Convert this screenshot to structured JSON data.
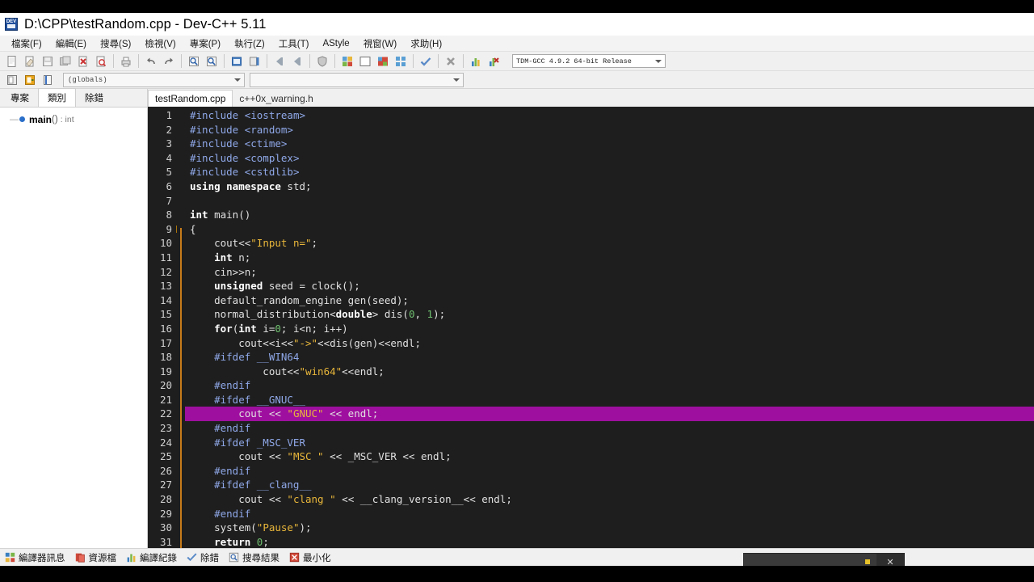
{
  "window": {
    "title": "D:\\CPP\\testRandom.cpp - Dev-C++ 5.11",
    "icon": "devcpp-app-icon"
  },
  "menubar": {
    "items": [
      {
        "label": "檔案(F)",
        "name": "menu-file"
      },
      {
        "label": "編輯(E)",
        "name": "menu-edit"
      },
      {
        "label": "搜尋(S)",
        "name": "menu-search"
      },
      {
        "label": "檢視(V)",
        "name": "menu-view"
      },
      {
        "label": "專案(P)",
        "name": "menu-project"
      },
      {
        "label": "執行(Z)",
        "name": "menu-execute"
      },
      {
        "label": "工具(T)",
        "name": "menu-tools"
      },
      {
        "label": "AStyle",
        "name": "menu-astyle"
      },
      {
        "label": "視窗(W)",
        "name": "menu-window"
      },
      {
        "label": "求助(H)",
        "name": "menu-help"
      }
    ]
  },
  "toolbar": {
    "buttons": [
      "new-file-icon",
      "open-file-icon",
      "save-file-icon",
      "save-all-icon",
      "close-file-icon",
      "print-preview-icon",
      "print-icon",
      "undo-icon",
      "redo-icon",
      "find-icon",
      "find-next-icon",
      "replace-icon",
      "goto-line-icon",
      "back-icon",
      "forward-icon",
      "shield-icon",
      "compile-icon",
      "run-icon",
      "compile-run-icon",
      "rebuild-all-icon",
      "syntax-check-icon",
      "stop-execution-icon",
      "profile-icon",
      "debug-icon"
    ],
    "compiler": {
      "value": "TDM-GCC 4.9.2 64-bit Release",
      "name": "compiler-set-select"
    }
  },
  "toolbar2": {
    "buttons": [
      "goto-declaration-icon",
      "goto-definition-icon",
      "browse-icon"
    ],
    "scope_combo": {
      "value": "(globals)",
      "name": "scope-select"
    },
    "member_combo": {
      "value": "",
      "name": "member-select"
    }
  },
  "left_panel": {
    "tabs": [
      {
        "label": "專案",
        "name": "panel-tab-project",
        "active": false
      },
      {
        "label": "類別",
        "name": "panel-tab-classes",
        "active": true
      },
      {
        "label": "除錯",
        "name": "panel-tab-debug",
        "active": false
      }
    ],
    "tree": [
      {
        "name": "main",
        "paren": "()",
        "type": ": int"
      }
    ]
  },
  "editor": {
    "tabs": [
      {
        "label": "testRandom.cpp",
        "name": "editor-tab-testrandom-cpp",
        "active": true
      },
      {
        "label": "c++0x_warning.h",
        "name": "editor-tab-cpp0x-warning-h",
        "active": false
      }
    ],
    "current_line": 22,
    "current_line_color": "#9f0f9f",
    "background": "#1e1e1e",
    "lines": [
      {
        "n": 1,
        "tokens": [
          {
            "t": "pre",
            "v": "#include "
          },
          {
            "t": "hdr",
            "v": "<iostream>"
          }
        ]
      },
      {
        "n": 2,
        "tokens": [
          {
            "t": "pre",
            "v": "#include "
          },
          {
            "t": "hdr",
            "v": "<random>"
          }
        ]
      },
      {
        "n": 3,
        "tokens": [
          {
            "t": "pre",
            "v": "#include "
          },
          {
            "t": "hdr",
            "v": "<ctime>"
          }
        ]
      },
      {
        "n": 4,
        "tokens": [
          {
            "t": "pre",
            "v": "#include "
          },
          {
            "t": "hdr",
            "v": "<complex>"
          }
        ]
      },
      {
        "n": 5,
        "tokens": [
          {
            "t": "pre",
            "v": "#include "
          },
          {
            "t": "hdr",
            "v": "<cstdlib>"
          }
        ]
      },
      {
        "n": 6,
        "tokens": [
          {
            "t": "kw",
            "v": "using namespace"
          },
          {
            "t": "id",
            "v": " std;"
          }
        ]
      },
      {
        "n": 7,
        "tokens": []
      },
      {
        "n": 8,
        "tokens": [
          {
            "t": "kw",
            "v": "int"
          },
          {
            "t": "id",
            "v": " main()"
          }
        ]
      },
      {
        "n": 9,
        "tokens": [
          {
            "t": "id",
            "v": "{"
          }
        ],
        "fold": true
      },
      {
        "n": 10,
        "tokens": [
          {
            "t": "id",
            "v": "    cout<<"
          },
          {
            "t": "str",
            "v": "\"Input n=\""
          },
          {
            "t": "id",
            "v": ";"
          }
        ]
      },
      {
        "n": 11,
        "tokens": [
          {
            "t": "id",
            "v": "    "
          },
          {
            "t": "kw",
            "v": "int"
          },
          {
            "t": "id",
            "v": " n;"
          }
        ]
      },
      {
        "n": 12,
        "tokens": [
          {
            "t": "id",
            "v": "    cin>>n;"
          }
        ]
      },
      {
        "n": 13,
        "tokens": [
          {
            "t": "id",
            "v": "    "
          },
          {
            "t": "kw",
            "v": "unsigned"
          },
          {
            "t": "id",
            "v": " seed = clock();"
          }
        ]
      },
      {
        "n": 14,
        "tokens": [
          {
            "t": "id",
            "v": "    default_random_engine gen(seed);"
          }
        ]
      },
      {
        "n": 15,
        "tokens": [
          {
            "t": "id",
            "v": "    normal_distribution<"
          },
          {
            "t": "kw",
            "v": "double"
          },
          {
            "t": "id",
            "v": "> dis("
          },
          {
            "t": "num",
            "v": "0"
          },
          {
            "t": "id",
            "v": ", "
          },
          {
            "t": "num",
            "v": "1"
          },
          {
            "t": "id",
            "v": ");"
          }
        ]
      },
      {
        "n": 16,
        "tokens": [
          {
            "t": "id",
            "v": "    "
          },
          {
            "t": "kw",
            "v": "for"
          },
          {
            "t": "id",
            "v": "("
          },
          {
            "t": "kw",
            "v": "int"
          },
          {
            "t": "id",
            "v": " i="
          },
          {
            "t": "num",
            "v": "0"
          },
          {
            "t": "id",
            "v": "; i<n; i++)"
          }
        ]
      },
      {
        "n": 17,
        "tokens": [
          {
            "t": "id",
            "v": "        cout<<i<<"
          },
          {
            "t": "str",
            "v": "\"->\""
          },
          {
            "t": "id",
            "v": "<<dis(gen)<<endl;"
          }
        ]
      },
      {
        "n": 18,
        "tokens": [
          {
            "t": "pre",
            "v": "    #ifdef __WIN64"
          }
        ]
      },
      {
        "n": 19,
        "tokens": [
          {
            "t": "id",
            "v": "            cout<<"
          },
          {
            "t": "str",
            "v": "\"win64\""
          },
          {
            "t": "id",
            "v": "<<endl;"
          }
        ]
      },
      {
        "n": 20,
        "tokens": [
          {
            "t": "pre",
            "v": "    #endif"
          }
        ]
      },
      {
        "n": 21,
        "tokens": [
          {
            "t": "pre",
            "v": "    #ifdef __GNUC__"
          }
        ]
      },
      {
        "n": 22,
        "tokens": [
          {
            "t": "id",
            "v": "        cout << "
          },
          {
            "t": "str",
            "v": "\"GNUC\""
          },
          {
            "t": "id",
            "v": " << endl;"
          }
        ],
        "current": true
      },
      {
        "n": 23,
        "tokens": [
          {
            "t": "pre",
            "v": "    #endif"
          }
        ]
      },
      {
        "n": 24,
        "tokens": [
          {
            "t": "pre",
            "v": "    #ifdef _MSC_VER"
          }
        ]
      },
      {
        "n": 25,
        "tokens": [
          {
            "t": "id",
            "v": "        cout << "
          },
          {
            "t": "str",
            "v": "\"MSC \""
          },
          {
            "t": "id",
            "v": " << _MSC_VER << endl;"
          }
        ]
      },
      {
        "n": 26,
        "tokens": [
          {
            "t": "pre",
            "v": "    #endif"
          }
        ]
      },
      {
        "n": 27,
        "tokens": [
          {
            "t": "pre",
            "v": "    #ifdef __clang__"
          }
        ]
      },
      {
        "n": 28,
        "tokens": [
          {
            "t": "id",
            "v": "        cout << "
          },
          {
            "t": "str",
            "v": "\"clang \""
          },
          {
            "t": "id",
            "v": " << __clang_version__<< endl;"
          }
        ]
      },
      {
        "n": 29,
        "tokens": [
          {
            "t": "pre",
            "v": "    #endif"
          }
        ]
      },
      {
        "n": 30,
        "tokens": [
          {
            "t": "id",
            "v": "    system("
          },
          {
            "t": "str",
            "v": "\"Pause\""
          },
          {
            "t": "id",
            "v": ");"
          }
        ]
      },
      {
        "n": 31,
        "tokens": [
          {
            "t": "id",
            "v": "    "
          },
          {
            "t": "kw",
            "v": "return"
          },
          {
            "t": "id",
            "v": " "
          },
          {
            "t": "num",
            "v": "0"
          },
          {
            "t": "id",
            "v": ";"
          }
        ]
      }
    ]
  },
  "statusbar": {
    "items": [
      {
        "label": "編譯器訊息",
        "icon": "compiler-messages-icon",
        "name": "status-tab-compiler"
      },
      {
        "label": "資源檔",
        "icon": "resource-file-icon",
        "name": "status-tab-resources"
      },
      {
        "label": "編譯紀錄",
        "icon": "compile-log-icon",
        "name": "status-tab-compile-log"
      },
      {
        "label": "除錯",
        "icon": "debug-check-icon",
        "name": "status-tab-debug"
      },
      {
        "label": "搜尋結果",
        "icon": "search-results-icon",
        "name": "status-tab-search-results"
      },
      {
        "label": "最小化",
        "icon": "minimize-icon",
        "name": "status-tab-minimize"
      }
    ]
  },
  "download_popup": {
    "text": "",
    "close_label": "✕",
    "name": "download-notification-bar"
  }
}
